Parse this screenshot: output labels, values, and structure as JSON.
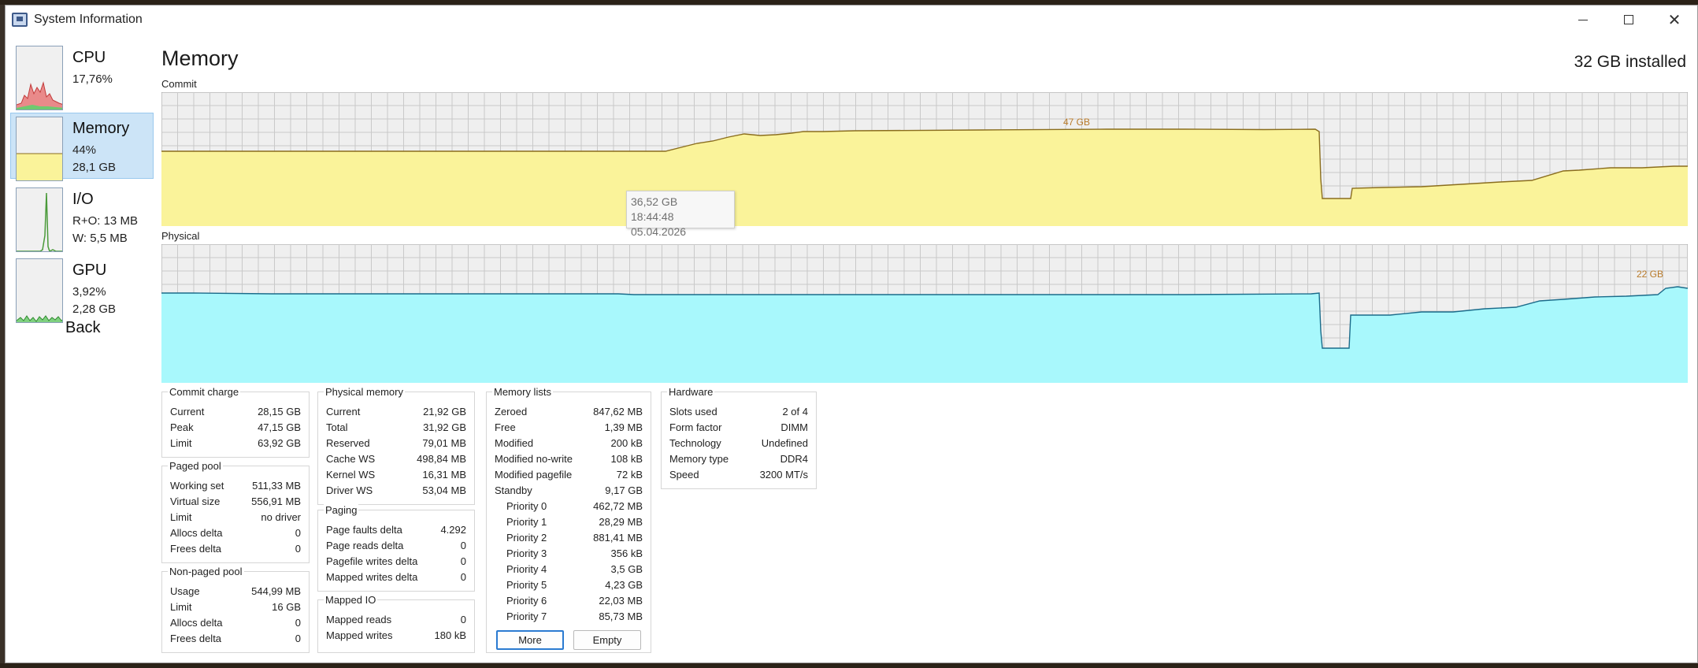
{
  "window": {
    "title": "System Information"
  },
  "sidebar": {
    "items": [
      {
        "name": "CPU",
        "v1": "17,76%",
        "v2": ""
      },
      {
        "name": "Memory",
        "v1": "44%",
        "v2": "28,1 GB"
      },
      {
        "name": "I/O",
        "v1": "R+O: 13 MB",
        "v2": "W: 5,5 MB"
      },
      {
        "name": "GPU",
        "v1": "3,92%",
        "v2": "2,28 GB"
      }
    ],
    "back": "Back"
  },
  "main": {
    "title": "Memory",
    "installed": "32 GB installed",
    "commit_label": "Commit",
    "physical_label": "Physical",
    "commit_peak_label": "47 GB",
    "physical_peak_label": "22 GB",
    "tooltip": {
      "value": "36,52 GB",
      "time": "18:44:48 05.04.2026"
    }
  },
  "panels": {
    "commit_charge": {
      "title": "Commit charge",
      "rows": [
        {
          "k": "Current",
          "v": "28,15 GB"
        },
        {
          "k": "Peak",
          "v": "47,15 GB"
        },
        {
          "k": "Limit",
          "v": "63,92 GB"
        }
      ]
    },
    "paged_pool": {
      "title": "Paged pool",
      "rows": [
        {
          "k": "Working set",
          "v": "511,33 MB"
        },
        {
          "k": "Virtual size",
          "v": "556,91 MB"
        },
        {
          "k": "Limit",
          "v": "no driver"
        },
        {
          "k": "Allocs delta",
          "v": "0"
        },
        {
          "k": "Frees delta",
          "v": "0"
        }
      ]
    },
    "non_paged_pool": {
      "title": "Non-paged pool",
      "rows": [
        {
          "k": "Usage",
          "v": "544,99 MB"
        },
        {
          "k": "Limit",
          "v": "16 GB"
        },
        {
          "k": "Allocs delta",
          "v": "0"
        },
        {
          "k": "Frees delta",
          "v": "0"
        }
      ]
    },
    "physical_memory": {
      "title": "Physical memory",
      "rows": [
        {
          "k": "Current",
          "v": "21,92 GB"
        },
        {
          "k": "Total",
          "v": "31,92 GB"
        },
        {
          "k": "Reserved",
          "v": "79,01 MB"
        },
        {
          "k": "Cache WS",
          "v": "498,84 MB"
        },
        {
          "k": "Kernel WS",
          "v": "16,31 MB"
        },
        {
          "k": "Driver WS",
          "v": "53,04 MB"
        }
      ]
    },
    "paging": {
      "title": "Paging",
      "rows": [
        {
          "k": "Page faults delta",
          "v": "4.292"
        },
        {
          "k": "Page reads delta",
          "v": "0"
        },
        {
          "k": "Pagefile writes delta",
          "v": "0"
        },
        {
          "k": "Mapped writes delta",
          "v": "0"
        }
      ]
    },
    "mapped_io": {
      "title": "Mapped IO",
      "rows": [
        {
          "k": "Mapped reads",
          "v": "0"
        },
        {
          "k": "Mapped writes",
          "v": "180 kB"
        }
      ]
    },
    "memory_lists": {
      "title": "Memory lists",
      "rows": [
        {
          "k": "Zeroed",
          "v": "847,62 MB"
        },
        {
          "k": "Free",
          "v": "1,39 MB"
        },
        {
          "k": "Modified",
          "v": "200 kB"
        },
        {
          "k": "Modified no-write",
          "v": "108 kB"
        },
        {
          "k": "Modified pagefile",
          "v": "72 kB"
        },
        {
          "k": "Standby",
          "v": "9,17 GB"
        }
      ],
      "priorities": [
        {
          "k": "Priority 0",
          "v": "462,72 MB"
        },
        {
          "k": "Priority 1",
          "v": "28,29 MB"
        },
        {
          "k": "Priority 2",
          "v": "881,41 MB"
        },
        {
          "k": "Priority 3",
          "v": "356 kB"
        },
        {
          "k": "Priority 4",
          "v": "3,5 GB"
        },
        {
          "k": "Priority 5",
          "v": "4,23 GB"
        },
        {
          "k": "Priority 6",
          "v": "22,03 MB"
        },
        {
          "k": "Priority 7",
          "v": "85,73 MB"
        }
      ],
      "more": "More",
      "empty": "Empty"
    },
    "hardware": {
      "title": "Hardware",
      "rows": [
        {
          "k": "Slots used",
          "v": "2 of 4"
        },
        {
          "k": "Form factor",
          "v": "DIMM"
        },
        {
          "k": "Technology",
          "v": "Undefined"
        },
        {
          "k": "Memory type",
          "v": "DDR4"
        },
        {
          "k": "Speed",
          "v": "3200 MT/s"
        }
      ]
    }
  },
  "colors": {
    "commit_fill": "#faf39a",
    "commit_line": "#8a6d1e",
    "physical_fill": "#a8f8fc",
    "physical_line": "#1b6b8a",
    "graph_bg": "#efefef",
    "grid": "#c8c8c8",
    "peak_label": "#b87a2a"
  }
}
